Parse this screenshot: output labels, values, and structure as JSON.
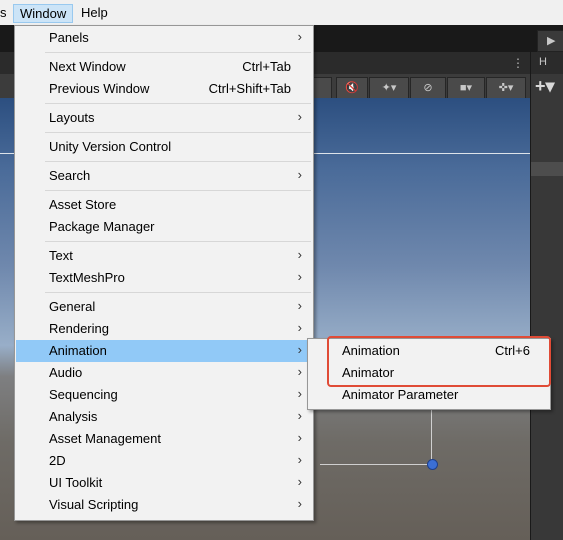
{
  "menubar": {
    "edge_label": "s",
    "window_label": "Window",
    "help_label": "Help"
  },
  "toolbar": {
    "play_icon": "play-icon"
  },
  "scene_toolbar": {
    "more_glyph": "⋮",
    "buttons": [
      {
        "name": "audio-mute-icon",
        "glyph": "🔇"
      },
      {
        "name": "effects-icon",
        "glyph": "✦▾"
      },
      {
        "name": "visibility-icon",
        "glyph": "⊘"
      },
      {
        "name": "camera-icon",
        "glyph": "■▾"
      },
      {
        "name": "gizmos-icon",
        "glyph": "✜▾"
      }
    ]
  },
  "right_panel": {
    "tab_label": "H",
    "add_glyph": "+▾"
  },
  "menu": {
    "items": [
      {
        "label": "Panels",
        "arrow": "›"
      },
      {
        "label": "Next Window",
        "shortcut": "Ctrl+Tab"
      },
      {
        "label": "Previous Window",
        "shortcut": "Ctrl+Shift+Tab"
      },
      {
        "label": "Layouts",
        "arrow": "›"
      },
      {
        "label": "Unity Version Control"
      },
      {
        "label": "Search",
        "arrow": "›"
      },
      {
        "label": "Asset Store"
      },
      {
        "label": "Package Manager"
      },
      {
        "label": "Text",
        "arrow": "›"
      },
      {
        "label": "TextMeshPro",
        "arrow": "›"
      },
      {
        "label": "General",
        "arrow": "›"
      },
      {
        "label": "Rendering",
        "arrow": "›"
      },
      {
        "label": "Animation",
        "arrow": "›"
      },
      {
        "label": "Audio",
        "arrow": "›"
      },
      {
        "label": "Sequencing",
        "arrow": "›"
      },
      {
        "label": "Analysis",
        "arrow": "›"
      },
      {
        "label": "Asset Management",
        "arrow": "›"
      },
      {
        "label": "2D",
        "arrow": "›"
      },
      {
        "label": "UI Toolkit",
        "arrow": "›"
      },
      {
        "label": "Visual Scripting",
        "arrow": "›"
      }
    ],
    "highlighted": "Animation"
  },
  "submenu": {
    "items": [
      {
        "label": "Animation",
        "shortcut": "Ctrl+6"
      },
      {
        "label": "Animator"
      },
      {
        "label": "Animator Parameter"
      }
    ]
  }
}
